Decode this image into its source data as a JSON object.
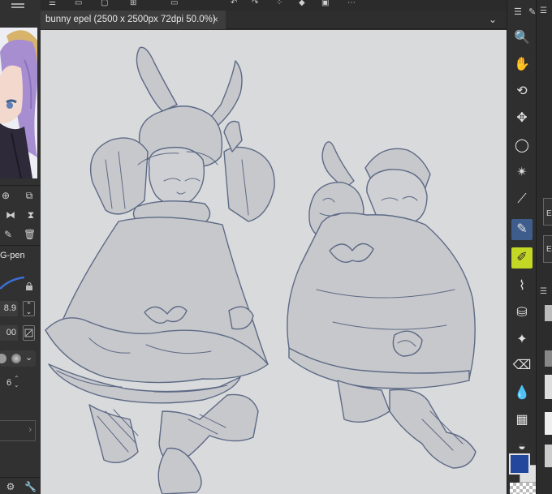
{
  "document_tab": {
    "title": "bunny epel (2500 x 2500px 72dpi 50.0%)",
    "close_glyph": "×",
    "menu_glyph": "⌄"
  },
  "brush": {
    "name": "G-pen",
    "size": "8.9",
    "opacity": "00",
    "stabilization": "6"
  },
  "colors": {
    "main": "#24479e",
    "sub": "#e0e0e0",
    "canvas_bg": "#d9dadc",
    "sketch_line": "#5d6a86",
    "active_tool": "#3f5d8c",
    "active_subtool": "#c3d825"
  },
  "tools": [
    {
      "icon": "zoom-icon",
      "glyph": "🔍"
    },
    {
      "icon": "hand-icon",
      "glyph": "✋"
    },
    {
      "icon": "rotate-icon",
      "glyph": "⟲"
    },
    {
      "icon": "move-icon",
      "glyph": "✥"
    },
    {
      "icon": "lasso-icon",
      "glyph": "◯"
    },
    {
      "icon": "auto-select-icon",
      "glyph": "✴"
    },
    {
      "icon": "eyedropper-icon",
      "glyph": "⟋"
    },
    {
      "icon": "pen-icon",
      "glyph": "✎"
    },
    {
      "icon": "pencil-icon",
      "glyph": "✐"
    },
    {
      "icon": "brush-icon",
      "glyph": "⌇"
    },
    {
      "icon": "airbrush-icon",
      "glyph": "⛁"
    },
    {
      "icon": "decoration-icon",
      "glyph": "✦"
    },
    {
      "icon": "eraser-icon",
      "glyph": "⌫"
    },
    {
      "icon": "blend-icon",
      "glyph": "💧"
    },
    {
      "icon": "fill-icon",
      "glyph": "▦"
    },
    {
      "icon": "gradient-icon",
      "glyph": "◒"
    }
  ],
  "right_panel": {
    "labels": [
      "E",
      "E"
    ]
  }
}
